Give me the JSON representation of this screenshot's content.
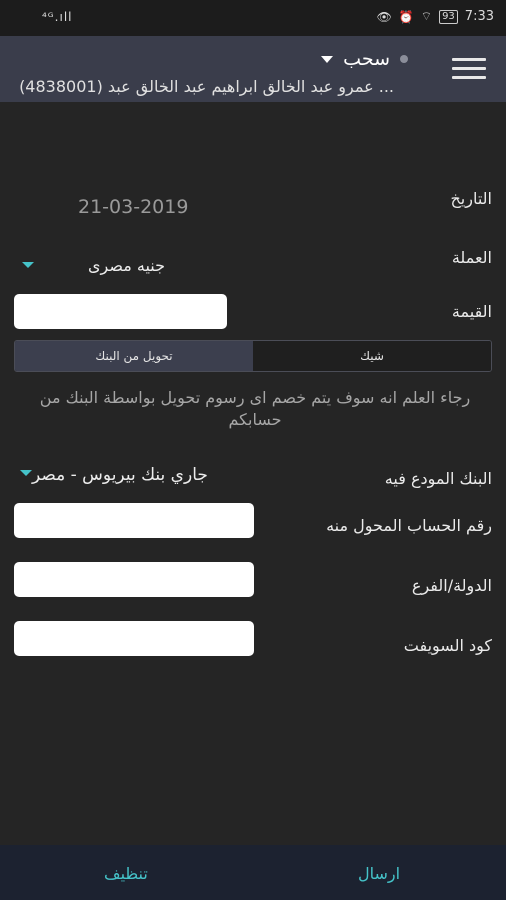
{
  "status_bar": {
    "left": "⁴ᴳ.ıll",
    "battery": "93",
    "time": "7:33"
  },
  "app_bar": {
    "title": "سحب",
    "account": "(4838001) عمرو عبد الخالق ابراهيم عبد الخالق عبد ..."
  },
  "form": {
    "date_label": "التاريخ",
    "date_value": "21-03-2019",
    "currency_label": "العملة",
    "currency_value": "جنيه مصرى",
    "amount_label": "القيمة",
    "amount_value": "",
    "tabs": {
      "check": "شيك",
      "bank_transfer": "تحويل من البنك"
    },
    "notice": "رجاء العلم انه سوف يتم خصم اى رسوم تحويل بواسطة البنك من حسابكم",
    "bank_label": "البنك المودع فيه",
    "bank_value": "جاري بنك بيريوس - مصر",
    "account_number_label": "رقم الحساب المحول منه",
    "account_number_value": "",
    "country_branch_label": "الدولة/الفرع",
    "country_branch_value": "",
    "swift_label": "كود السويفت",
    "swift_value": ""
  },
  "bottom_bar": {
    "send": "ارسال",
    "clear": "تنظيف"
  },
  "colors": {
    "accent": "#45c3c9",
    "app_bar": "#3a3d4b",
    "background": "#252525"
  },
  "icons": {
    "menu": "hamburger-menu-icon",
    "dropdown": "triangle-down-icon"
  }
}
